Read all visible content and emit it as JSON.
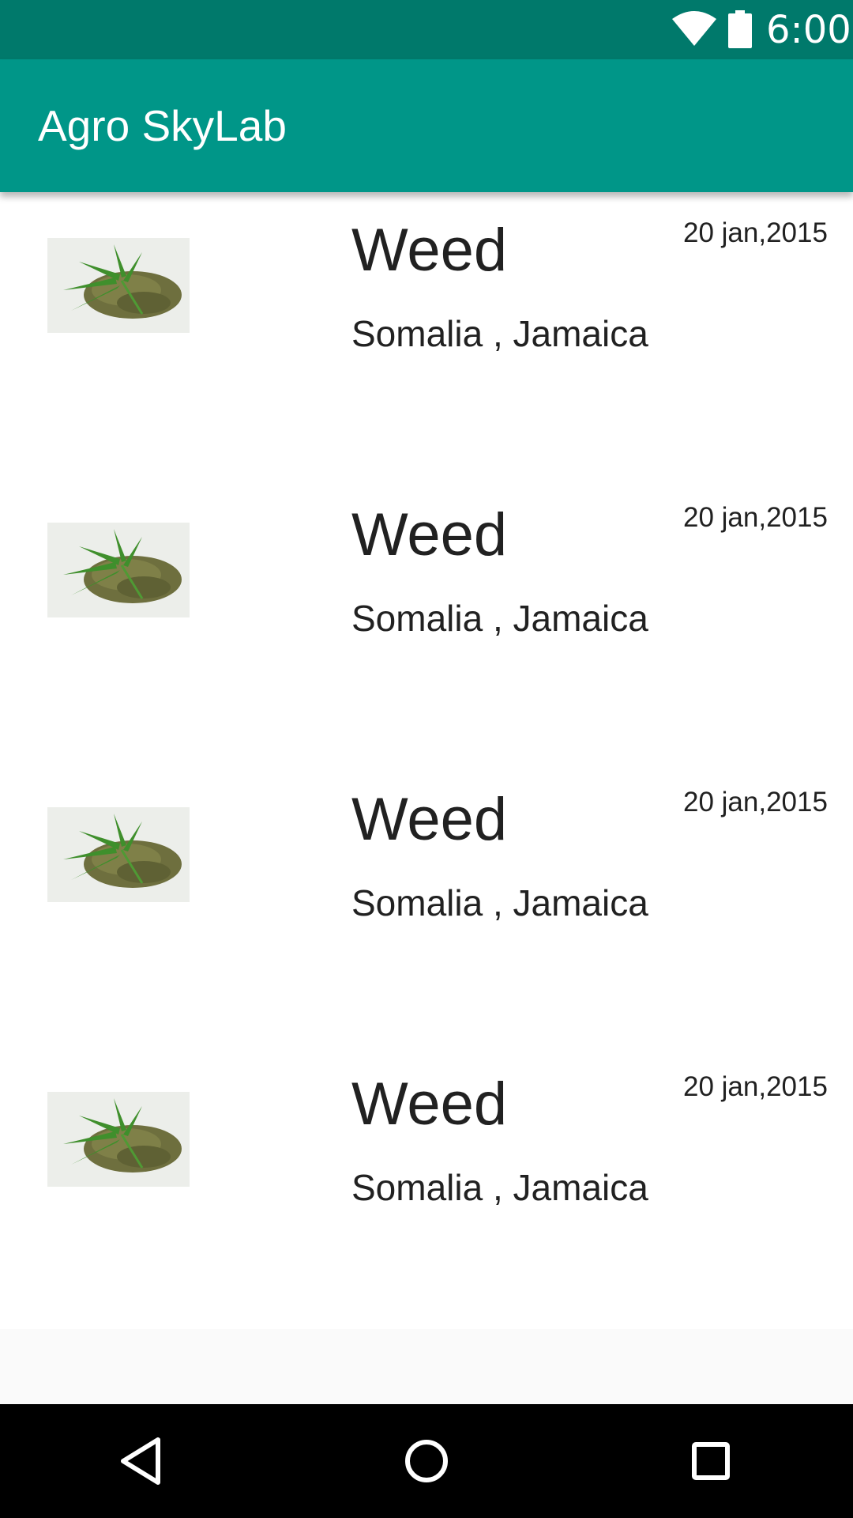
{
  "status_bar": {
    "time": "6:00",
    "icons": [
      "wifi-icon",
      "battery-icon"
    ]
  },
  "app_bar": {
    "title": "Agro SkyLab"
  },
  "list": {
    "items": [
      {
        "title": "Weed",
        "subtitle": "Somalia , Jamaica",
        "date": "20 jan,2015",
        "image": "cannabis-leaf-image"
      },
      {
        "title": "Weed",
        "subtitle": "Somalia , Jamaica",
        "date": "20 jan,2015",
        "image": "cannabis-leaf-image"
      },
      {
        "title": "Weed",
        "subtitle": "Somalia , Jamaica",
        "date": "20 jan,2015",
        "image": "cannabis-leaf-image"
      },
      {
        "title": "Weed",
        "subtitle": "Somalia , Jamaica",
        "date": "20 jan,2015",
        "image": "cannabis-leaf-image"
      }
    ]
  },
  "nav_bar": {
    "buttons": [
      "back-icon",
      "home-icon",
      "recents-icon"
    ]
  },
  "colors": {
    "status_bar": "#00796b",
    "app_bar": "#009688",
    "text": "#212121",
    "nav_bar": "#000000"
  }
}
